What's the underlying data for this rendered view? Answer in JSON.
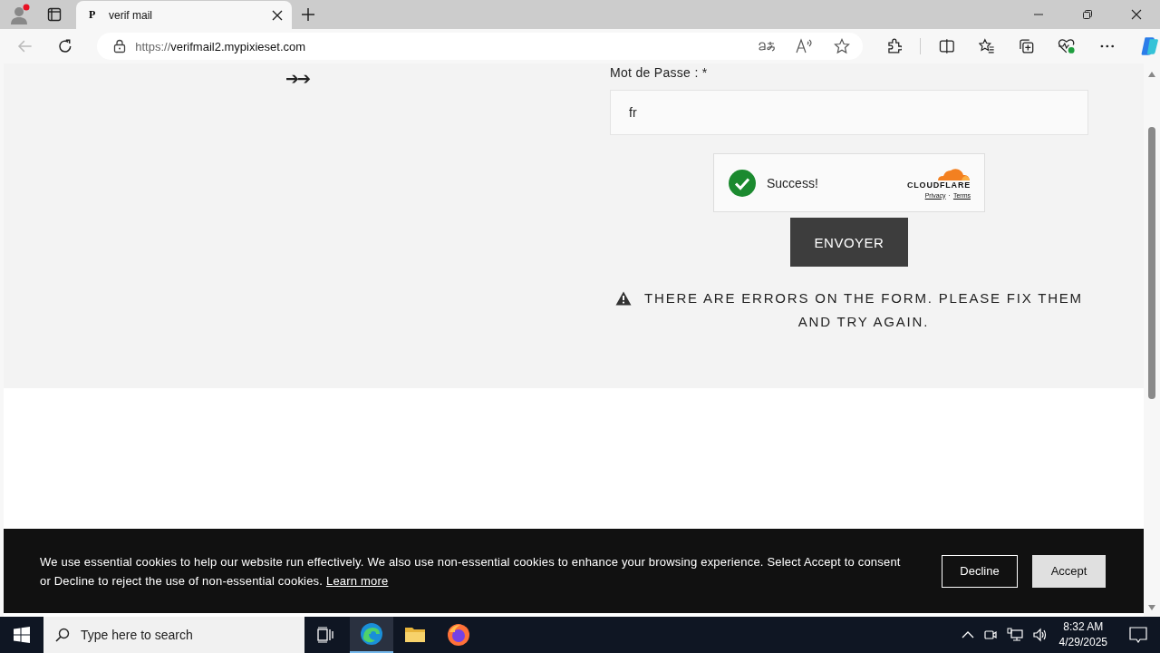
{
  "browser": {
    "tab": {
      "favicon": "P",
      "title": "verif mail"
    },
    "url": {
      "scheme": "https://",
      "host": "verifmail2.mypixieset.com"
    }
  },
  "page": {
    "arrows": "➔➔",
    "form": {
      "password_label": "Mot de Passe : *",
      "password_value": "fr",
      "captcha": {
        "status": "Success!",
        "brand": "CLOUDFLARE",
        "links": [
          "Privacy",
          "Terms"
        ],
        "separator": "·"
      },
      "submit": "ENVOYER",
      "error": "THERE ARE ERRORS ON THE FORM. PLEASE FIX THEM AND TRY AGAIN."
    }
  },
  "cookie_banner": {
    "text": "We use essential cookies to help our website run effectively. We also use non-essential cookies to enhance your browsing experience. Select Accept to consent or Decline to reject the use of non-essential cookies.",
    "link": "Learn more",
    "buttons": [
      "Decline",
      "Accept"
    ]
  },
  "taskbar": {
    "search_placeholder": "Type here to search",
    "time": "8:32 AM",
    "date": "4/29/2025"
  }
}
